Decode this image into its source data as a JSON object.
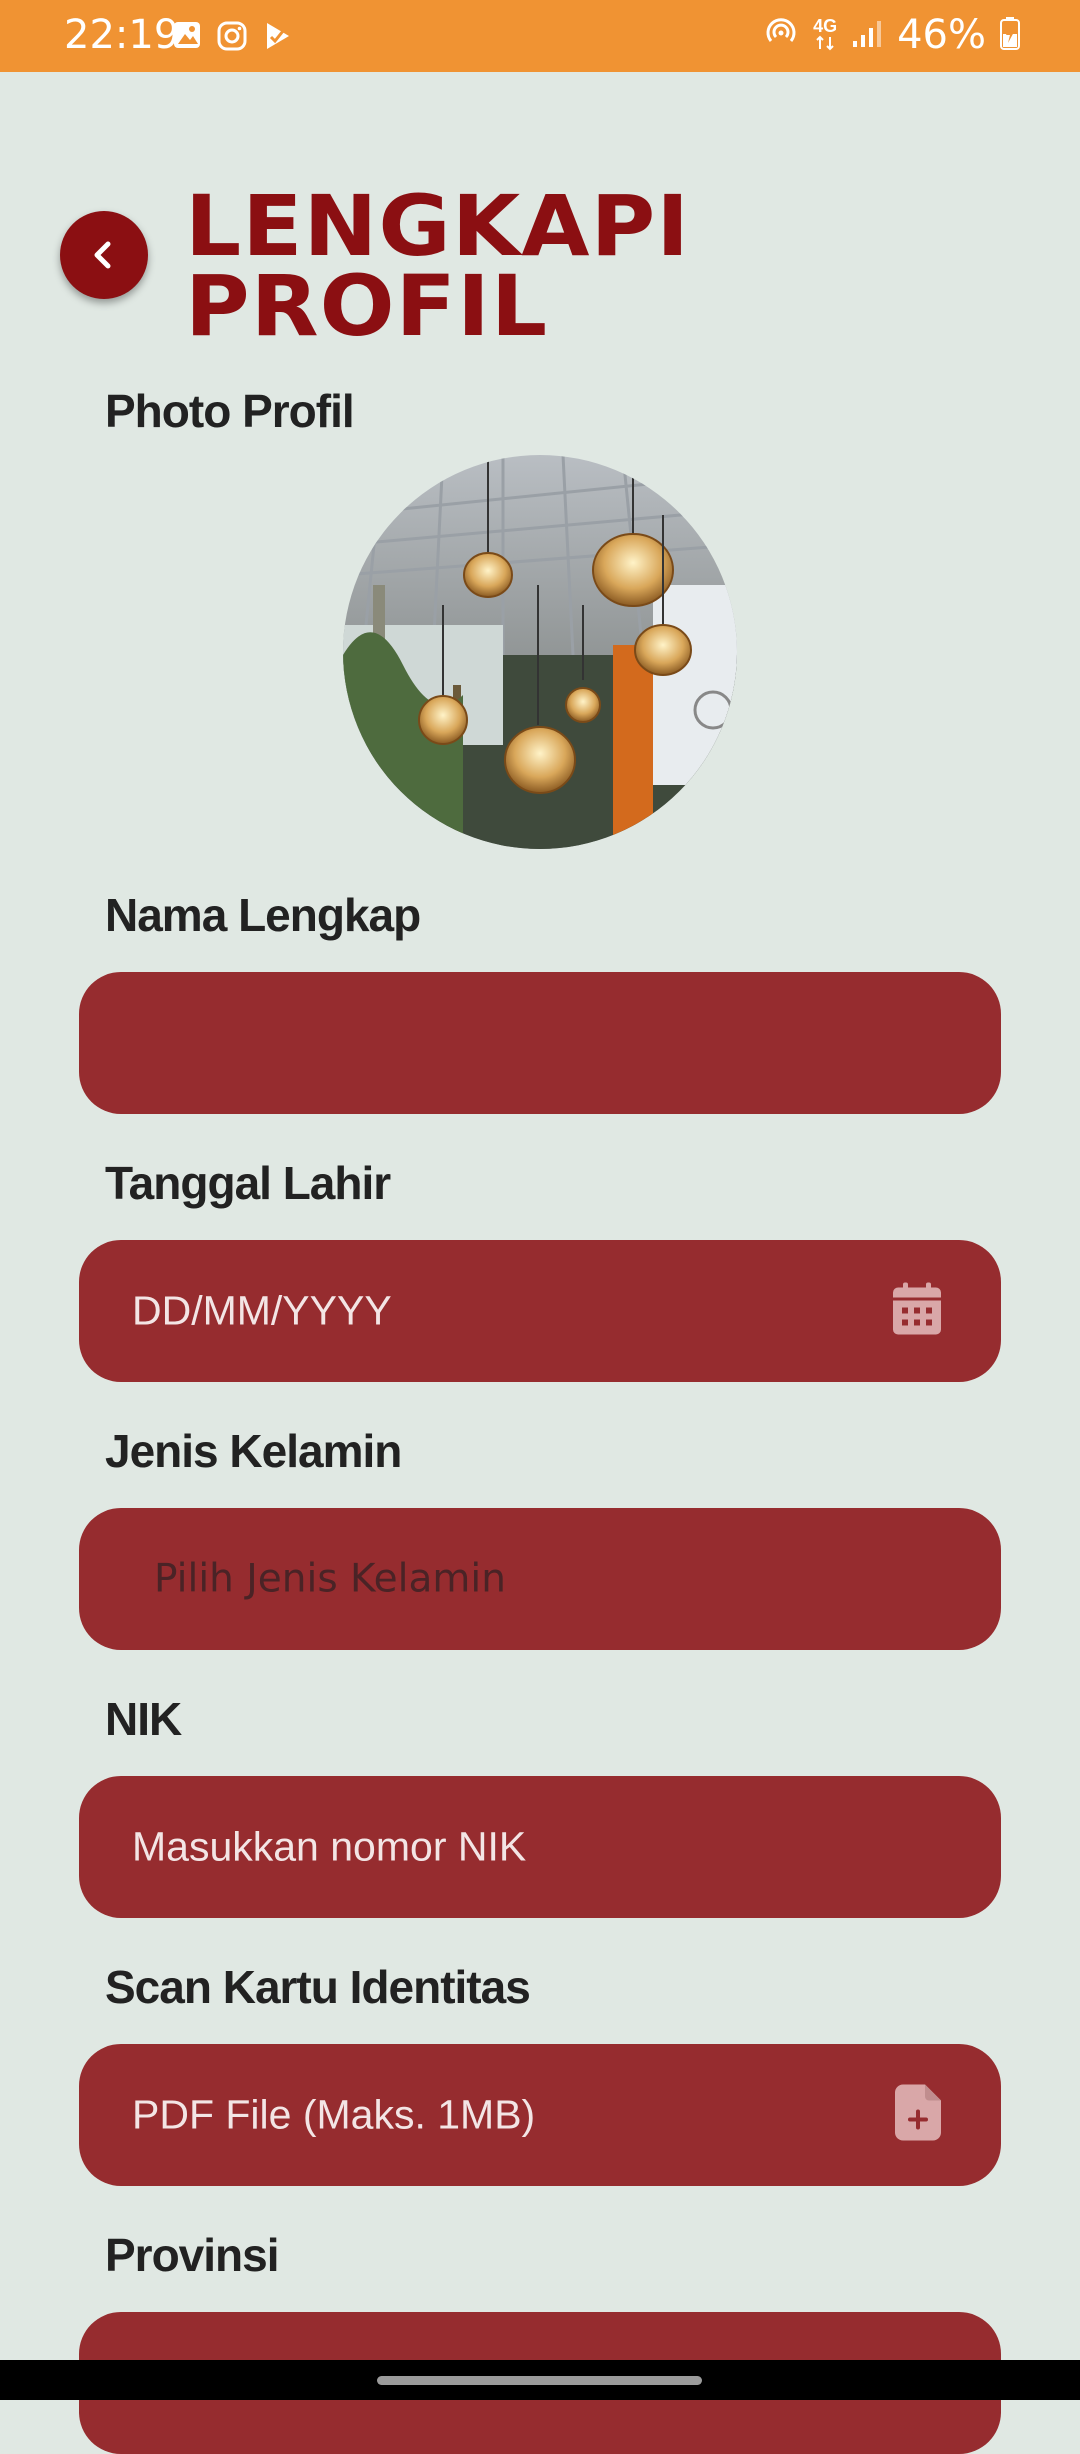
{
  "status": {
    "time": "22:19",
    "network": "4G",
    "battery": "46%",
    "icons": [
      "gallery-icon",
      "instagram-icon",
      "play-store-icon",
      "hotspot-icon",
      "signal-icon",
      "battery-icon"
    ]
  },
  "header": {
    "title": "LENGKAPI PROFIL",
    "back_icon": "chevron-left-icon"
  },
  "photo": {
    "label": "Photo Profil"
  },
  "form": {
    "nama": {
      "label": "Nama Lengkap",
      "value": ""
    },
    "tanggal": {
      "label": "Tanggal Lahir",
      "placeholder": "DD/MM/YYYY",
      "icon": "calendar-icon"
    },
    "gender": {
      "label": "Jenis Kelamin",
      "placeholder": "Pilih Jenis Kelamin"
    },
    "nik": {
      "label": "NIK",
      "placeholder": "Masukkan nomor NIK"
    },
    "scan": {
      "label": "Scan Kartu Identitas",
      "placeholder": "PDF File (Maks. 1MB)",
      "icon": "file-add-icon"
    },
    "provinsi": {
      "label": "Provinsi"
    }
  },
  "colors": {
    "statusbar": "#f09333",
    "background": "#e0e8e3",
    "accent": "#8b0f12",
    "field": "#962c2f"
  }
}
